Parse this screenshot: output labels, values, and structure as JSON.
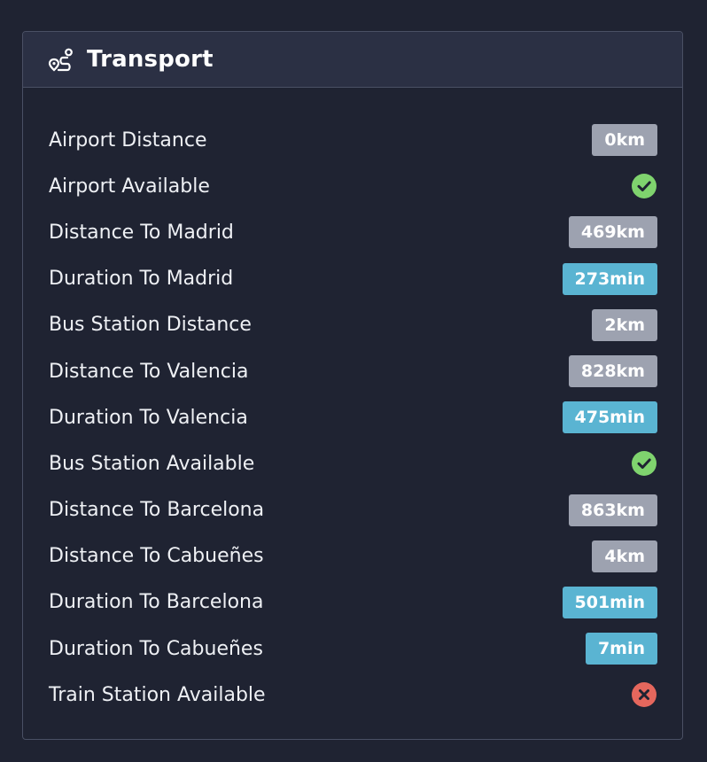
{
  "card": {
    "title": "Transport",
    "icon": "route-icon"
  },
  "colors": {
    "background": "#1f2332",
    "header": "#2b3044",
    "border": "#4a5064",
    "badge_grey": "#9da2b0",
    "badge_blue": "#5ab4d2",
    "status_yes": "#7fd36e",
    "status_no": "#e5675d"
  },
  "rows": [
    {
      "label": "Airport Distance",
      "value": "0km"
    },
    {
      "label": "Airport Available",
      "status": "check-circle-icon"
    },
    {
      "label": "Distance To Madrid",
      "value": "469km"
    },
    {
      "label": "Duration To Madrid",
      "value": "273min"
    },
    {
      "label": "Bus Station Distance",
      "value": "2km"
    },
    {
      "label": "Distance To Valencia",
      "value": "828km"
    },
    {
      "label": "Duration To Valencia",
      "value": "475min"
    },
    {
      "label": "Bus Station Available",
      "status": "check-circle-icon"
    },
    {
      "label": "Distance To Barcelona",
      "value": "863km"
    },
    {
      "label": "Distance To Cabueñes",
      "value": "4km"
    },
    {
      "label": "Duration To Barcelona",
      "value": "501min"
    },
    {
      "label": "Duration To Cabueñes",
      "value": "7min"
    },
    {
      "label": "Train Station Available",
      "status": "x-circle-icon"
    }
  ]
}
